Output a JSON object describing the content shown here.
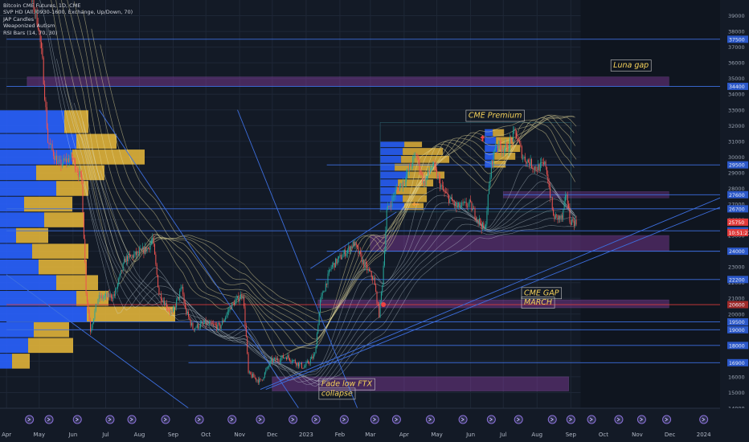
{
  "legend": {
    "title": "Bitcoin CME Futures, 1D, CME",
    "lines": [
      "SVP HD (All, 0930-1600, Exchange, Up/Down, 70)",
      "JAP Candles",
      "Weaponized Autism",
      "RSI Bars (14, 70, 30)"
    ]
  },
  "colors": {
    "background": "#131a26",
    "bullish": "#26a69a",
    "bearish": "#ef5350",
    "volume_up": "#2962ff",
    "volume_down": "#e0b23a",
    "level_line": "#3d6fe0",
    "red_line": "#d83b3b",
    "zone_purple": "#8d3fa8",
    "annotation_text": "#f6d25a"
  },
  "chart_data": {
    "type": "candlestick",
    "ylim": [
      14000,
      40000
    ],
    "y_ticks": [
      14000,
      15000,
      16000,
      17000,
      18000,
      19000,
      20000,
      21000,
      22000,
      23000,
      24000,
      25000,
      26000,
      27000,
      28000,
      29000,
      30000,
      31000,
      32000,
      33000,
      34000,
      35000,
      36000,
      37000,
      38000,
      39000
    ],
    "x_ticks": [
      {
        "label": "Apr",
        "date": "2022-04-01"
      },
      {
        "label": "May",
        "date": "2022-05-01"
      },
      {
        "label": "Jun",
        "date": "2022-06-01"
      },
      {
        "label": "Jul",
        "date": "2022-07-01"
      },
      {
        "label": "Aug",
        "date": "2022-08-01"
      },
      {
        "label": "Sep",
        "date": "2022-09-01"
      },
      {
        "label": "Oct",
        "date": "2022-10-01"
      },
      {
        "label": "Nov",
        "date": "2022-11-01"
      },
      {
        "label": "Dec",
        "date": "2022-12-01"
      },
      {
        "label": "2023",
        "date": "2023-01-01"
      },
      {
        "label": "Feb",
        "date": "2023-02-01"
      },
      {
        "label": "Mar",
        "date": "2023-03-01"
      },
      {
        "label": "Apr",
        "date": "2023-04-01"
      },
      {
        "label": "May",
        "date": "2023-05-01"
      },
      {
        "label": "Jun",
        "date": "2023-06-01"
      },
      {
        "label": "Jul",
        "date": "2023-07-01"
      },
      {
        "label": "Aug",
        "date": "2023-08-01"
      },
      {
        "label": "Sep",
        "date": "2023-09-01"
      },
      {
        "label": "Oct",
        "date": "2023-10-01"
      },
      {
        "label": "Nov",
        "date": "2023-11-01"
      },
      {
        "label": "Dec",
        "date": "2023-12-01"
      },
      {
        "label": "2024",
        "date": "2024-01-01"
      }
    ],
    "price_path": [
      [
        "2022-04-01",
        45000
      ],
      [
        "2022-04-20",
        41500
      ],
      [
        "2022-05-01",
        38500
      ],
      [
        "2022-05-05",
        36000
      ],
      [
        "2022-05-10",
        31000
      ],
      [
        "2022-05-20",
        29500
      ],
      [
        "2022-06-01",
        30000
      ],
      [
        "2022-06-10",
        28500
      ],
      [
        "2022-06-14",
        21500
      ],
      [
        "2022-06-18",
        19000
      ],
      [
        "2022-06-25",
        21000
      ],
      [
        "2022-07-10",
        21200
      ],
      [
        "2022-07-20",
        23500
      ],
      [
        "2022-07-30",
        23800
      ],
      [
        "2022-08-10",
        24200
      ],
      [
        "2022-08-14",
        24800
      ],
      [
        "2022-08-20",
        21300
      ],
      [
        "2022-09-01",
        20000
      ],
      [
        "2022-09-10",
        21700
      ],
      [
        "2022-09-13",
        20300
      ],
      [
        "2022-09-20",
        19100
      ],
      [
        "2022-10-01",
        19400
      ],
      [
        "2022-10-15",
        19200
      ],
      [
        "2022-10-25",
        20500
      ],
      [
        "2022-11-05",
        21300
      ],
      [
        "2022-11-08",
        18500
      ],
      [
        "2022-11-10",
        16200
      ],
      [
        "2022-11-21",
        15700
      ],
      [
        "2022-12-01",
        17000
      ],
      [
        "2022-12-15",
        17300
      ],
      [
        "2022-12-31",
        16600
      ],
      [
        "2023-01-10",
        17400
      ],
      [
        "2023-01-15",
        20800
      ],
      [
        "2023-01-25",
        23000
      ],
      [
        "2023-02-01",
        23500
      ],
      [
        "2023-02-15",
        24500
      ],
      [
        "2023-02-24",
        23200
      ],
      [
        "2023-03-05",
        22200
      ],
      [
        "2023-03-10",
        20000
      ],
      [
        "2023-03-13",
        22000
      ],
      [
        "2023-03-17",
        26500
      ],
      [
        "2023-03-25",
        27800
      ],
      [
        "2023-04-01",
        28400
      ],
      [
        "2023-04-13",
        30200
      ],
      [
        "2023-04-20",
        28300
      ],
      [
        "2023-04-28",
        29500
      ],
      [
        "2023-05-08",
        27800
      ],
      [
        "2023-05-20",
        26800
      ],
      [
        "2023-06-01",
        27000
      ],
      [
        "2023-06-15",
        25300
      ],
      [
        "2023-06-21",
        29500
      ],
      [
        "2023-06-25",
        30800
      ],
      [
        "2023-07-05",
        30500
      ],
      [
        "2023-07-13",
        31600
      ],
      [
        "2023-07-20",
        30000
      ],
      [
        "2023-08-01",
        29300
      ],
      [
        "2023-08-10",
        29500
      ],
      [
        "2023-08-17",
        26200
      ],
      [
        "2023-08-25",
        26100
      ],
      [
        "2023-08-29",
        27700
      ],
      [
        "2023-09-01",
        26000
      ],
      [
        "2023-09-07",
        25800
      ]
    ],
    "horizontal_levels": [
      {
        "value": 37500,
        "label": "37500",
        "color": "#3d6fe0"
      },
      {
        "value": 34500,
        "label": "34400",
        "color": "#3d6fe0"
      },
      {
        "value": 29500,
        "label": "29500",
        "color": "#3d6fe0"
      },
      {
        "value": 27600,
        "label": "27600",
        "color": "#3d6fe0"
      },
      {
        "value": 26700,
        "label": "26700",
        "color": "#3d6fe0"
      },
      {
        "value": 25300,
        "label": "25300",
        "color": "#3d6fe0"
      },
      {
        "value": 24000,
        "label": "24000",
        "color": "#3d6fe0"
      },
      {
        "value": 22200,
        "label": "22200",
        "color": "#3d6fe0"
      },
      {
        "value": 20600,
        "label": "20600",
        "color": "#d83b3b"
      },
      {
        "value": 19500,
        "label": "19500",
        "color": "#3d6fe0"
      },
      {
        "value": 19000,
        "label": "19000",
        "color": "#3d6fe0"
      },
      {
        "value": 18000,
        "label": "18000",
        "color": "#3d6fe0"
      },
      {
        "value": 16900,
        "label": "16900",
        "color": "#3d6fe0"
      }
    ],
    "price_labels": [
      {
        "value": 25750,
        "label": "25750"
      },
      {
        "value": 25340,
        "label": "10:51:21"
      }
    ],
    "zones": [
      {
        "name": "luna-gap",
        "start": "2022-04-20",
        "end": "2023-11-30",
        "y0": 34500,
        "y1": 35100
      },
      {
        "name": "premium-gap",
        "start": "2023-03-01",
        "end": "2023-11-30",
        "y0": 24000,
        "y1": 25000
      },
      {
        "name": "cme-gap-march",
        "start": "2023-01-12",
        "end": "2023-11-30",
        "y0": 20400,
        "y1": 20900
      },
      {
        "name": "ftx-gap",
        "start": "2022-12-01",
        "end": "2023-08-30",
        "y0": 15100,
        "y1": 16000
      },
      {
        "name": "level-band",
        "start": "2023-07-01",
        "end": "2023-11-30",
        "y0": 27400,
        "y1": 27800
      }
    ],
    "annotations": [
      {
        "text": "Luna gap",
        "date": "2023-10-10",
        "value": 35700
      },
      {
        "text": "CME Premium",
        "date": "2023-05-30",
        "value": 32500
      },
      {
        "text": "CME GAP",
        "date": "2023-07-20",
        "value": 21200
      },
      {
        "text": "MARCH",
        "date": "2023-07-20",
        "value": 20600
      },
      {
        "text": "Fade low FTX",
        "date": "2023-01-15",
        "value": 15400
      },
      {
        "text": "collapse",
        "date": "2023-01-15",
        "value": 14800
      }
    ]
  }
}
